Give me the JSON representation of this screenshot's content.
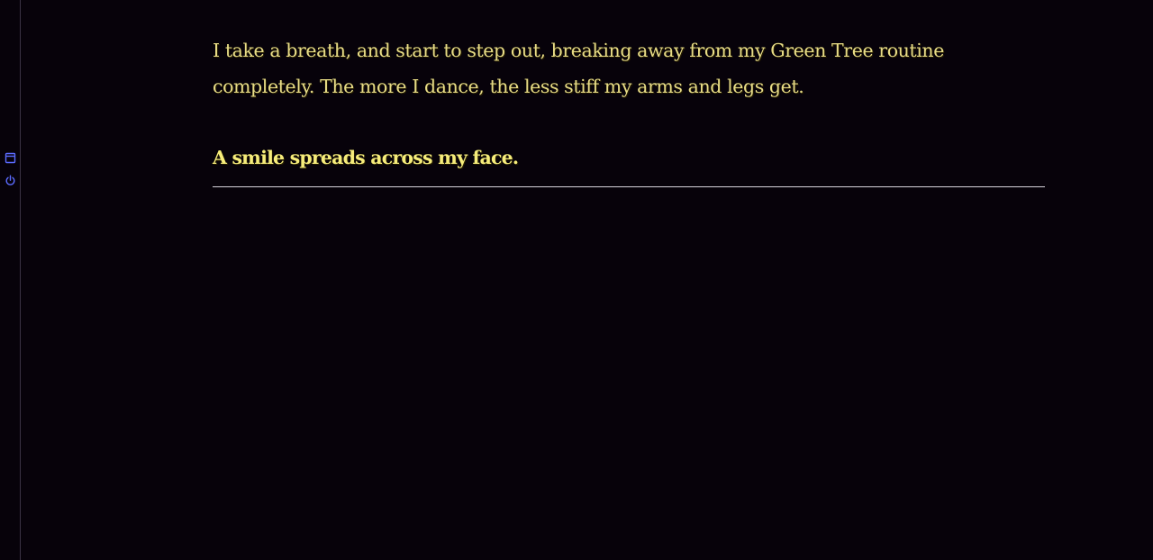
{
  "sidebar": {
    "icons": [
      {
        "name": "save-icon",
        "color": "#5b6bff"
      },
      {
        "name": "restart-icon",
        "color": "#5b6bff"
      }
    ]
  },
  "passage": {
    "paragraph": "I take a breath, and start to step out, breaking away from my Green Tree routine completely. The more I dance, the less stiff my arms and legs get.",
    "emphasis": "A smile spreads across my face."
  },
  "colors": {
    "background": "#07020a",
    "text": "#e8dc86",
    "emphasis_text": "#f6ec7a",
    "rule": "#d8d4dc",
    "icon": "#5b6bff"
  }
}
